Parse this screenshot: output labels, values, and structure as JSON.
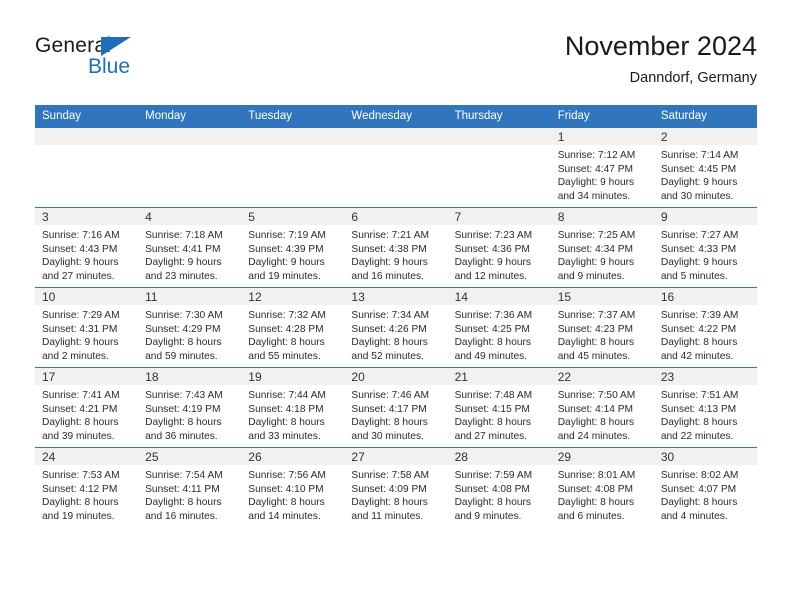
{
  "brand": {
    "line1": "General",
    "line2": "Blue",
    "accent_color": "#1d70b7",
    "triangle_icon": "brand-triangle-icon"
  },
  "header": {
    "title": "November 2024",
    "subtitle": "Danndorf, Germany"
  },
  "theme": {
    "header_blue": "#3176bc",
    "band_gray": "#f1f1f1",
    "text": "#2b2b2b"
  },
  "calendar": {
    "weekdays": [
      "Sunday",
      "Monday",
      "Tuesday",
      "Wednesday",
      "Thursday",
      "Friday",
      "Saturday"
    ],
    "labels": {
      "sunrise": "Sunrise:",
      "sunset": "Sunset:",
      "daylight": "Daylight:"
    },
    "weeks": [
      [
        {
          "empty": true
        },
        {
          "empty": true
        },
        {
          "empty": true
        },
        {
          "empty": true
        },
        {
          "empty": true
        },
        {
          "day": "1",
          "sunrise": "Sunrise: 7:12 AM",
          "sunset": "Sunset: 4:47 PM",
          "daylight_l1": "Daylight: 9 hours",
          "daylight_l2": "and 34 minutes."
        },
        {
          "day": "2",
          "sunrise": "Sunrise: 7:14 AM",
          "sunset": "Sunset: 4:45 PM",
          "daylight_l1": "Daylight: 9 hours",
          "daylight_l2": "and 30 minutes."
        }
      ],
      [
        {
          "day": "3",
          "sunrise": "Sunrise: 7:16 AM",
          "sunset": "Sunset: 4:43 PM",
          "daylight_l1": "Daylight: 9 hours",
          "daylight_l2": "and 27 minutes."
        },
        {
          "day": "4",
          "sunrise": "Sunrise: 7:18 AM",
          "sunset": "Sunset: 4:41 PM",
          "daylight_l1": "Daylight: 9 hours",
          "daylight_l2": "and 23 minutes."
        },
        {
          "day": "5",
          "sunrise": "Sunrise: 7:19 AM",
          "sunset": "Sunset: 4:39 PM",
          "daylight_l1": "Daylight: 9 hours",
          "daylight_l2": "and 19 minutes."
        },
        {
          "day": "6",
          "sunrise": "Sunrise: 7:21 AM",
          "sunset": "Sunset: 4:38 PM",
          "daylight_l1": "Daylight: 9 hours",
          "daylight_l2": "and 16 minutes."
        },
        {
          "day": "7",
          "sunrise": "Sunrise: 7:23 AM",
          "sunset": "Sunset: 4:36 PM",
          "daylight_l1": "Daylight: 9 hours",
          "daylight_l2": "and 12 minutes."
        },
        {
          "day": "8",
          "sunrise": "Sunrise: 7:25 AM",
          "sunset": "Sunset: 4:34 PM",
          "daylight_l1": "Daylight: 9 hours",
          "daylight_l2": "and 9 minutes."
        },
        {
          "day": "9",
          "sunrise": "Sunrise: 7:27 AM",
          "sunset": "Sunset: 4:33 PM",
          "daylight_l1": "Daylight: 9 hours",
          "daylight_l2": "and 5 minutes."
        }
      ],
      [
        {
          "day": "10",
          "sunrise": "Sunrise: 7:29 AM",
          "sunset": "Sunset: 4:31 PM",
          "daylight_l1": "Daylight: 9 hours",
          "daylight_l2": "and 2 minutes."
        },
        {
          "day": "11",
          "sunrise": "Sunrise: 7:30 AM",
          "sunset": "Sunset: 4:29 PM",
          "daylight_l1": "Daylight: 8 hours",
          "daylight_l2": "and 59 minutes."
        },
        {
          "day": "12",
          "sunrise": "Sunrise: 7:32 AM",
          "sunset": "Sunset: 4:28 PM",
          "daylight_l1": "Daylight: 8 hours",
          "daylight_l2": "and 55 minutes."
        },
        {
          "day": "13",
          "sunrise": "Sunrise: 7:34 AM",
          "sunset": "Sunset: 4:26 PM",
          "daylight_l1": "Daylight: 8 hours",
          "daylight_l2": "and 52 minutes."
        },
        {
          "day": "14",
          "sunrise": "Sunrise: 7:36 AM",
          "sunset": "Sunset: 4:25 PM",
          "daylight_l1": "Daylight: 8 hours",
          "daylight_l2": "and 49 minutes."
        },
        {
          "day": "15",
          "sunrise": "Sunrise: 7:37 AM",
          "sunset": "Sunset: 4:23 PM",
          "daylight_l1": "Daylight: 8 hours",
          "daylight_l2": "and 45 minutes."
        },
        {
          "day": "16",
          "sunrise": "Sunrise: 7:39 AM",
          "sunset": "Sunset: 4:22 PM",
          "daylight_l1": "Daylight: 8 hours",
          "daylight_l2": "and 42 minutes."
        }
      ],
      [
        {
          "day": "17",
          "sunrise": "Sunrise: 7:41 AM",
          "sunset": "Sunset: 4:21 PM",
          "daylight_l1": "Daylight: 8 hours",
          "daylight_l2": "and 39 minutes."
        },
        {
          "day": "18",
          "sunrise": "Sunrise: 7:43 AM",
          "sunset": "Sunset: 4:19 PM",
          "daylight_l1": "Daylight: 8 hours",
          "daylight_l2": "and 36 minutes."
        },
        {
          "day": "19",
          "sunrise": "Sunrise: 7:44 AM",
          "sunset": "Sunset: 4:18 PM",
          "daylight_l1": "Daylight: 8 hours",
          "daylight_l2": "and 33 minutes."
        },
        {
          "day": "20",
          "sunrise": "Sunrise: 7:46 AM",
          "sunset": "Sunset: 4:17 PM",
          "daylight_l1": "Daylight: 8 hours",
          "daylight_l2": "and 30 minutes."
        },
        {
          "day": "21",
          "sunrise": "Sunrise: 7:48 AM",
          "sunset": "Sunset: 4:15 PM",
          "daylight_l1": "Daylight: 8 hours",
          "daylight_l2": "and 27 minutes."
        },
        {
          "day": "22",
          "sunrise": "Sunrise: 7:50 AM",
          "sunset": "Sunset: 4:14 PM",
          "daylight_l1": "Daylight: 8 hours",
          "daylight_l2": "and 24 minutes."
        },
        {
          "day": "23",
          "sunrise": "Sunrise: 7:51 AM",
          "sunset": "Sunset: 4:13 PM",
          "daylight_l1": "Daylight: 8 hours",
          "daylight_l2": "and 22 minutes."
        }
      ],
      [
        {
          "day": "24",
          "sunrise": "Sunrise: 7:53 AM",
          "sunset": "Sunset: 4:12 PM",
          "daylight_l1": "Daylight: 8 hours",
          "daylight_l2": "and 19 minutes."
        },
        {
          "day": "25",
          "sunrise": "Sunrise: 7:54 AM",
          "sunset": "Sunset: 4:11 PM",
          "daylight_l1": "Daylight: 8 hours",
          "daylight_l2": "and 16 minutes."
        },
        {
          "day": "26",
          "sunrise": "Sunrise: 7:56 AM",
          "sunset": "Sunset: 4:10 PM",
          "daylight_l1": "Daylight: 8 hours",
          "daylight_l2": "and 14 minutes."
        },
        {
          "day": "27",
          "sunrise": "Sunrise: 7:58 AM",
          "sunset": "Sunset: 4:09 PM",
          "daylight_l1": "Daylight: 8 hours",
          "daylight_l2": "and 11 minutes."
        },
        {
          "day": "28",
          "sunrise": "Sunrise: 7:59 AM",
          "sunset": "Sunset: 4:08 PM",
          "daylight_l1": "Daylight: 8 hours",
          "daylight_l2": "and 9 minutes."
        },
        {
          "day": "29",
          "sunrise": "Sunrise: 8:01 AM",
          "sunset": "Sunset: 4:08 PM",
          "daylight_l1": "Daylight: 8 hours",
          "daylight_l2": "and 6 minutes."
        },
        {
          "day": "30",
          "sunrise": "Sunrise: 8:02 AM",
          "sunset": "Sunset: 4:07 PM",
          "daylight_l1": "Daylight: 8 hours",
          "daylight_l2": "and 4 minutes."
        }
      ]
    ]
  }
}
